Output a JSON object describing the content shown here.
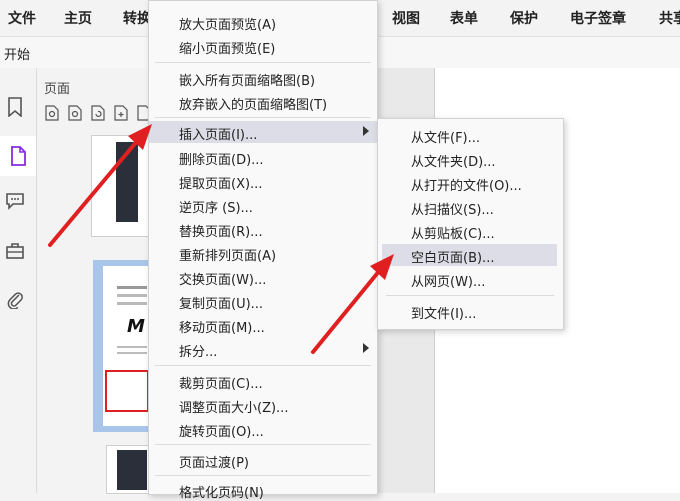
{
  "menubar": {
    "tabs": [
      "文件",
      "主页",
      "转换",
      "视图",
      "表单",
      "保护",
      "电子签章",
      "共享"
    ]
  },
  "toolbar": {
    "start_label": "开始"
  },
  "rail": {
    "icons": [
      "bookmark-icon",
      "pages-icon",
      "comment-icon",
      "briefcase-icon",
      "attachment-icon"
    ]
  },
  "panel": {
    "title": "页面",
    "tool_icons": [
      "zoom-in-thumb-icon",
      "zoom-out-thumb-icon",
      "rotate-thumb-icon",
      "insert-thumb-icon",
      "more-thumb-icon"
    ],
    "thumb_text": "M"
  },
  "context_menu": {
    "items": [
      {
        "label": "放大页面预览(A)"
      },
      {
        "label": "缩小页面预览(E)"
      },
      {
        "label": "嵌入所有页面缩略图(B)"
      },
      {
        "label": "放弃嵌入的页面缩略图(T)"
      },
      {
        "label": "插入页面(I)...",
        "highlighted": true,
        "submenu": true
      },
      {
        "label": "删除页面(D)..."
      },
      {
        "label": "提取页面(X)..."
      },
      {
        "label": "逆页序 (S)..."
      },
      {
        "label": "替换页面(R)..."
      },
      {
        "label": "重新排列页面(A)"
      },
      {
        "label": "交换页面(W)..."
      },
      {
        "label": "复制页面(U)..."
      },
      {
        "label": "移动页面(M)..."
      },
      {
        "label": "拆分...",
        "submenu": true
      },
      {
        "label": "裁剪页面(C)..."
      },
      {
        "label": "调整页面大小(Z)..."
      },
      {
        "label": "旋转页面(O)..."
      },
      {
        "label": "页面过渡(P)"
      },
      {
        "label": "格式化页码(N)"
      }
    ]
  },
  "submenu": {
    "items": [
      {
        "label": "从文件(F)..."
      },
      {
        "label": "从文件夹(D)..."
      },
      {
        "label": "从打开的文件(O)..."
      },
      {
        "label": "从扫描仪(S)..."
      },
      {
        "label": "从剪贴板(C)..."
      },
      {
        "label": "空白页面(B)...",
        "highlighted": true
      },
      {
        "label": "从网页(W)..."
      },
      {
        "label": "到文件(I)..."
      }
    ]
  },
  "colors": {
    "highlight": "#dcdde6",
    "annotation_arrow": "#e02020",
    "active_rail_icon": "#8a2be2"
  }
}
